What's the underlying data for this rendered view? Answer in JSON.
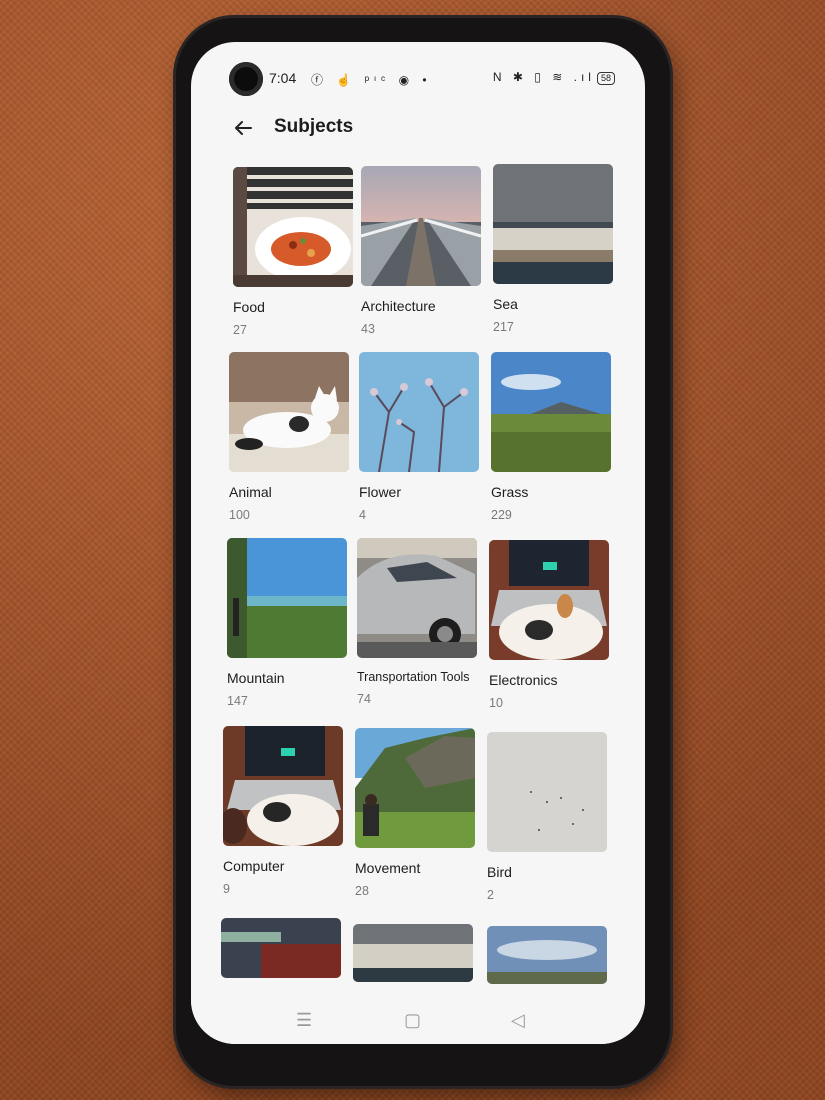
{
  "status_bar": {
    "time": "7:04",
    "notification_icons": "ⓕ ☝ ᵖᶦᶜ ◉ •",
    "system_icons": "N ✱ ▯ ≋ .ıl",
    "battery": "58"
  },
  "header": {
    "title": "Subjects"
  },
  "subjects": [
    {
      "name": "Food",
      "count": "27"
    },
    {
      "name": "Architecture",
      "count": "43"
    },
    {
      "name": "Sea",
      "count": "217"
    },
    {
      "name": "Animal",
      "count": "100"
    },
    {
      "name": "Flower",
      "count": "4"
    },
    {
      "name": "Grass",
      "count": "229"
    },
    {
      "name": "Mountain",
      "count": "147"
    },
    {
      "name": "Transportation Tools",
      "count": "74"
    },
    {
      "name": "Electronics",
      "count": "10"
    },
    {
      "name": "Computer",
      "count": "9"
    },
    {
      "name": "Movement",
      "count": "28"
    },
    {
      "name": "Bird",
      "count": "2"
    }
  ],
  "nav": {
    "menu": "☰",
    "home": "▢",
    "back": "◁"
  }
}
